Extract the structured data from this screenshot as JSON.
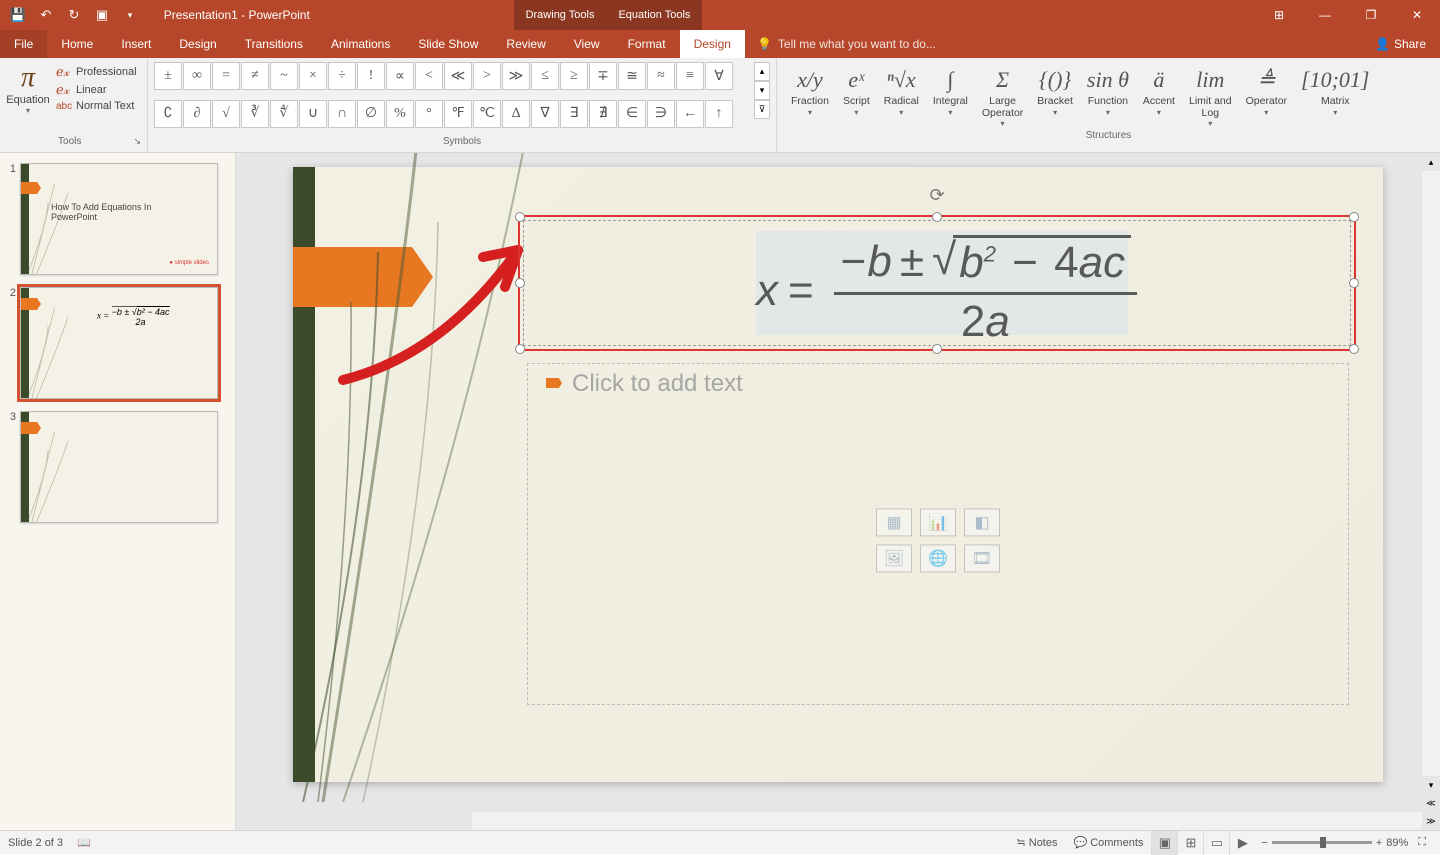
{
  "app": {
    "title": "Presentation1 - PowerPoint"
  },
  "window": {
    "ribbon_display": "⊞",
    "min": "—",
    "restore": "❐",
    "close": "✕"
  },
  "qat": [
    "save-icon",
    "undo-icon",
    "redo-icon",
    "start-icon",
    "customize-qat"
  ],
  "tool_tabs": {
    "drawing": "Drawing Tools",
    "equation": "Equation Tools"
  },
  "tabs": [
    "File",
    "Home",
    "Insert",
    "Design",
    "Transitions",
    "Animations",
    "Slide Show",
    "Review",
    "View",
    "Format",
    "Design"
  ],
  "active_tab_index": 10,
  "tell_me": "Tell me what you want to do...",
  "share": "Share",
  "ribbon": {
    "tools": {
      "equation": "Equation",
      "professional": "Professional",
      "linear": "Linear",
      "normal": "Normal Text",
      "label": "Tools"
    },
    "symbols": {
      "label": "Symbols",
      "row1": [
        "±",
        "∞",
        "=",
        "≠",
        "~",
        "×",
        "÷",
        "!",
        "∝",
        "<",
        "≪",
        ">",
        "≫",
        "≤",
        "≥",
        "∓",
        "≅",
        "≈",
        "≡",
        "∀"
      ],
      "row2": [
        "∁",
        "∂",
        "√",
        "∛",
        "∜",
        "∪",
        "∩",
        "∅",
        "%",
        "°",
        "℉",
        "℃",
        "∆",
        "∇",
        "∃",
        "∄",
        "∈",
        "∋",
        "←",
        "↑"
      ]
    },
    "structures": {
      "label": "Structures",
      "items": [
        {
          "icon": "x/y",
          "label": "Fraction"
        },
        {
          "icon": "eˣ",
          "label": "Script"
        },
        {
          "icon": "ⁿ√x",
          "label": "Radical"
        },
        {
          "icon": "∫",
          "label": "Integral"
        },
        {
          "icon": "Σ",
          "label": "Large\nOperator"
        },
        {
          "icon": "{()}",
          "label": "Bracket"
        },
        {
          "icon": "sin θ",
          "label": "Function"
        },
        {
          "icon": "ä",
          "label": "Accent"
        },
        {
          "icon": "lim",
          "label": "Limit and\nLog"
        },
        {
          "icon": "≜",
          "label": "Operator"
        },
        {
          "icon": "[10;01]",
          "label": "Matrix"
        }
      ]
    }
  },
  "thumbs": {
    "slide1": {
      "title": "How To Add Equations In PowerPoint",
      "logo": "simple slides"
    },
    "slide2": {
      "eq": "x = (−b ± √(b²−4ac)) / 2a"
    }
  },
  "slide": {
    "equation": {
      "x": "x",
      "eq": "=",
      "neg": "−",
      "b": "b",
      "pm": "±",
      "b2": "b",
      "sq": "2",
      "minus": "−",
      "four": "4",
      "a": "a",
      "c": "c",
      "two": "2",
      "a2": "a"
    },
    "placeholder": "Click to add text"
  },
  "status": {
    "slide": "Slide 2 of 3",
    "notes": "Notes",
    "comments": "Comments",
    "zoom": "89%"
  }
}
